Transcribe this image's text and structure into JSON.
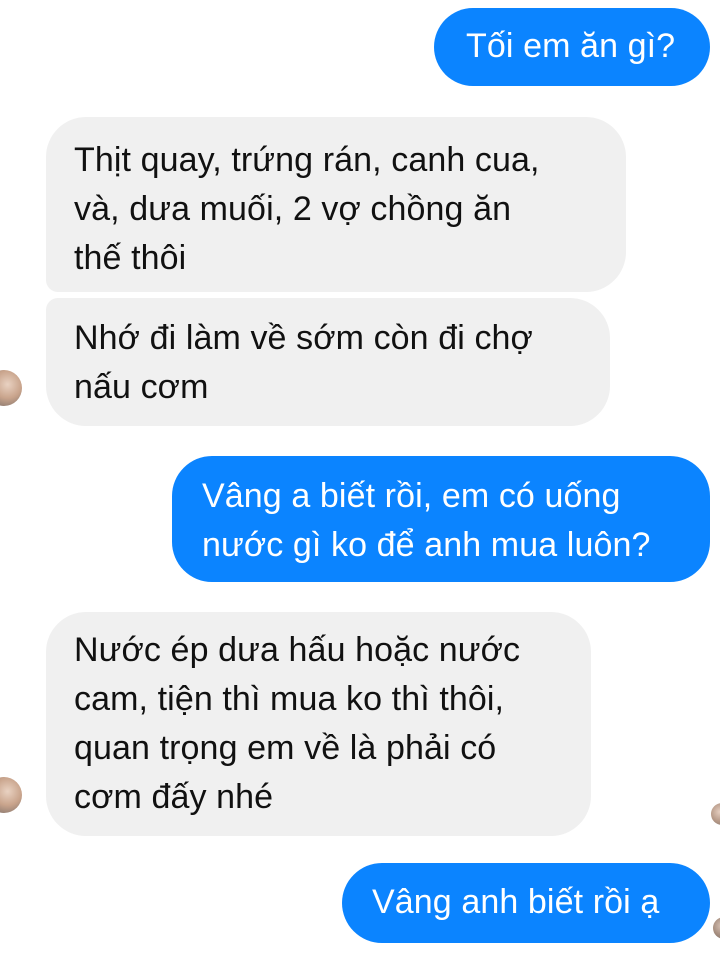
{
  "colors": {
    "outgoing_bubble": "#0b84ff",
    "incoming_bubble": "#f0f0f0",
    "outgoing_text": "#ffffff",
    "incoming_text": "#111111"
  },
  "messages": [
    {
      "sender": "me",
      "text": "Tối em ăn gì?"
    },
    {
      "sender": "other",
      "text": "Thịt quay, trứng rán, canh cua,\nvà, dưa muối, 2 vợ chồng ăn\nthế thôi"
    },
    {
      "sender": "other",
      "text": "Nhớ đi làm về sớm còn đi chợ\nnấu cơm"
    },
    {
      "sender": "me",
      "text": "Vâng a biết rồi, em có uống\nnước gì ko để anh mua luôn?"
    },
    {
      "sender": "other",
      "text": "Nước ép dưa hấu hoặc nước\ncam, tiện thì mua ko thì thôi,\nquan trọng em về là phải có\ncơm đấy nhé"
    },
    {
      "sender": "me",
      "text": "Vâng anh biết rồi ạ"
    }
  ],
  "icons": {
    "contact_avatar": "contact-avatar-icon",
    "read_receipt": "read-receipt-avatar-icon"
  }
}
